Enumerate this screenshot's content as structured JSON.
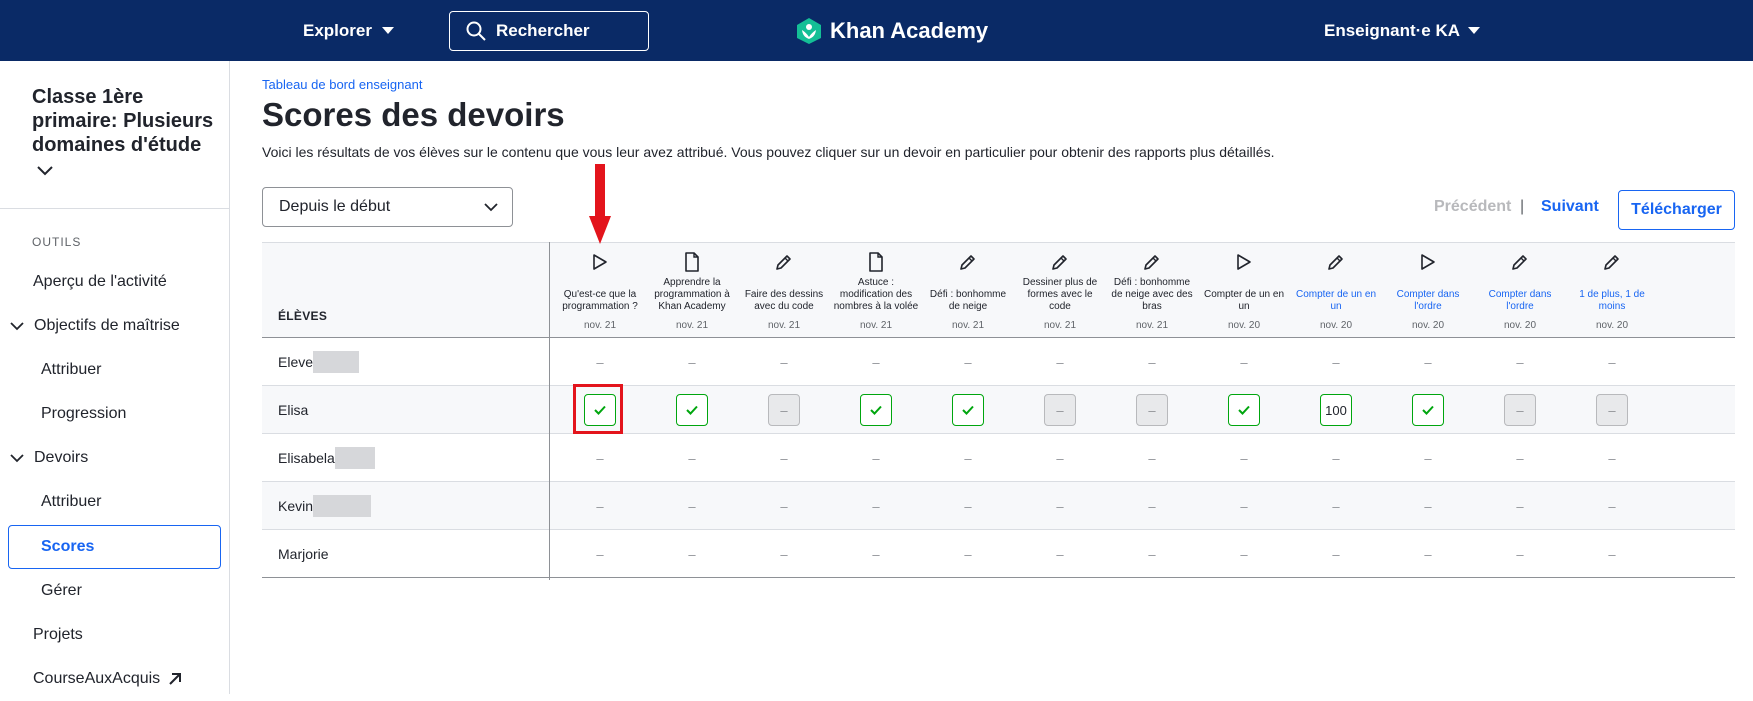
{
  "topbar": {
    "explore_label": "Explorer",
    "search_label": "Rechercher",
    "logo_text": "Khan Academy",
    "user_label": "Enseignant·e KA"
  },
  "sidebar": {
    "class_title": "Classe 1ère primaire: Plusieurs domaines d'étude",
    "tools_label": "OUTILS",
    "items": [
      {
        "label": "Aperçu de l'activité"
      },
      {
        "label": "Objectifs de maîtrise"
      },
      {
        "label": "Attribuer"
      },
      {
        "label": "Progression"
      },
      {
        "label": "Devoirs"
      },
      {
        "label": "Attribuer"
      },
      {
        "label": "Scores"
      },
      {
        "label": "Gérer"
      },
      {
        "label": "Projets"
      },
      {
        "label": "CourseAuxAcquis"
      }
    ]
  },
  "main": {
    "breadcrumb": "Tableau de bord enseignant",
    "title": "Scores des devoirs",
    "description": "Voici les résultats de vos élèves sur le contenu que vous leur avez attribué. Vous pouvez cliquer sur un devoir en particulier pour obtenir des rapports plus détaillés.",
    "date_range": "Depuis le début",
    "prev_label": "Précédent",
    "separator": "|",
    "next_label": "Suivant",
    "download_label": "Télécharger"
  },
  "table": {
    "students_header": "ÉLÈVES",
    "columns": [
      {
        "title": "Qu'est-ce que la programmation ?",
        "date": "nov. 21",
        "icon": "play-icon"
      },
      {
        "title": "Apprendre la programmation à Khan Academy",
        "date": "nov. 21",
        "icon": "article-icon"
      },
      {
        "title": "Faire des dessins avec du code",
        "date": "nov. 21",
        "icon": "pencil-icon"
      },
      {
        "title": "Astuce : modification des nombres à la volée",
        "date": "nov. 21",
        "icon": "article-icon"
      },
      {
        "title": "Défi : bonhomme de neige",
        "date": "nov. 21",
        "icon": "pencil-icon"
      },
      {
        "title": "Dessiner plus de formes avec le code",
        "date": "nov. 21",
        "icon": "pencil-icon"
      },
      {
        "title": "Défi : bonhomme de neige avec des bras",
        "date": "nov. 21",
        "icon": "pencil-icon"
      },
      {
        "title": "Compter de un en un",
        "date": "nov. 20",
        "icon": "play-icon"
      },
      {
        "title": "Compter de un en un",
        "date": "nov. 20",
        "icon": "pencil-icon"
      },
      {
        "title": "Compter dans l'ordre",
        "date": "nov. 20",
        "icon": "play-icon"
      },
      {
        "title": "Compter dans l'ordre",
        "date": "nov. 20",
        "icon": "pencil-icon"
      },
      {
        "title": "1 de plus, 1 de moins",
        "date": "nov. 20",
        "icon": "pencil-icon"
      }
    ],
    "empty_mark": "–",
    "score_value": "100",
    "rows": [
      {
        "name": "Eleve",
        "cells": [
          "–",
          "–",
          "–",
          "–",
          "–",
          "–",
          "–",
          "–",
          "–",
          "–",
          "–",
          "–"
        ]
      },
      {
        "name": "Elisa",
        "cells": [
          "check",
          "check",
          "–",
          "check",
          "check",
          "–",
          "–",
          "check",
          "100",
          "check",
          "–",
          "–"
        ]
      },
      {
        "name": "Elisabela",
        "cells": [
          "–",
          "–",
          "–",
          "–",
          "–",
          "–",
          "–",
          "–",
          "–",
          "–",
          "–",
          "–"
        ]
      },
      {
        "name": "Kevin",
        "cells": [
          "–",
          "–",
          "–",
          "–",
          "–",
          "–",
          "–",
          "–",
          "–",
          "–",
          "–",
          "–"
        ]
      },
      {
        "name": "Marjorie",
        "cells": [
          "–",
          "–",
          "–",
          "–",
          "–",
          "–",
          "–",
          "–",
          "–",
          "–",
          "–",
          "–"
        ]
      }
    ]
  },
  "colors": {
    "topbar": "#0a2a66",
    "accent": "#1865f2",
    "success": "#00a60e",
    "annotation": "#e3141c"
  }
}
